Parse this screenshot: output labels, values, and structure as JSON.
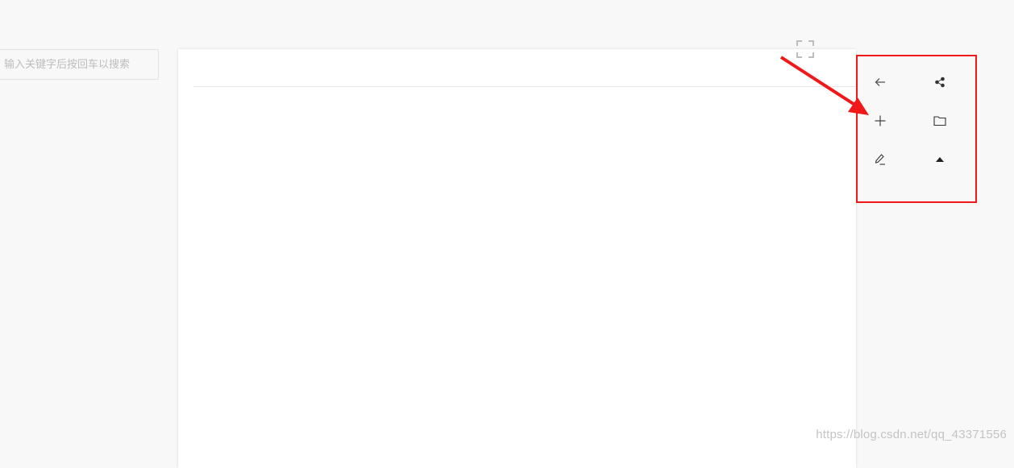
{
  "search": {
    "placeholder": "输入关键字后按回车以搜索",
    "value": ""
  },
  "toolbar": {
    "highlight_color": "#f01818",
    "buttons": [
      {
        "name": "back",
        "icon": "arrow-left-icon"
      },
      {
        "name": "share",
        "icon": "share-icon"
      },
      {
        "name": "add",
        "icon": "plus-icon"
      },
      {
        "name": "folder",
        "icon": "folder-icon"
      },
      {
        "name": "edit",
        "icon": "pencil-icon"
      },
      {
        "name": "scroll-top",
        "icon": "triangle-up-icon"
      }
    ]
  },
  "fullscreen": {
    "icon": "fullscreen-icon"
  },
  "annotation": {
    "color": "#f01818",
    "icon": "red-arrow"
  },
  "watermark": "https://blog.csdn.net/qq_43371556"
}
